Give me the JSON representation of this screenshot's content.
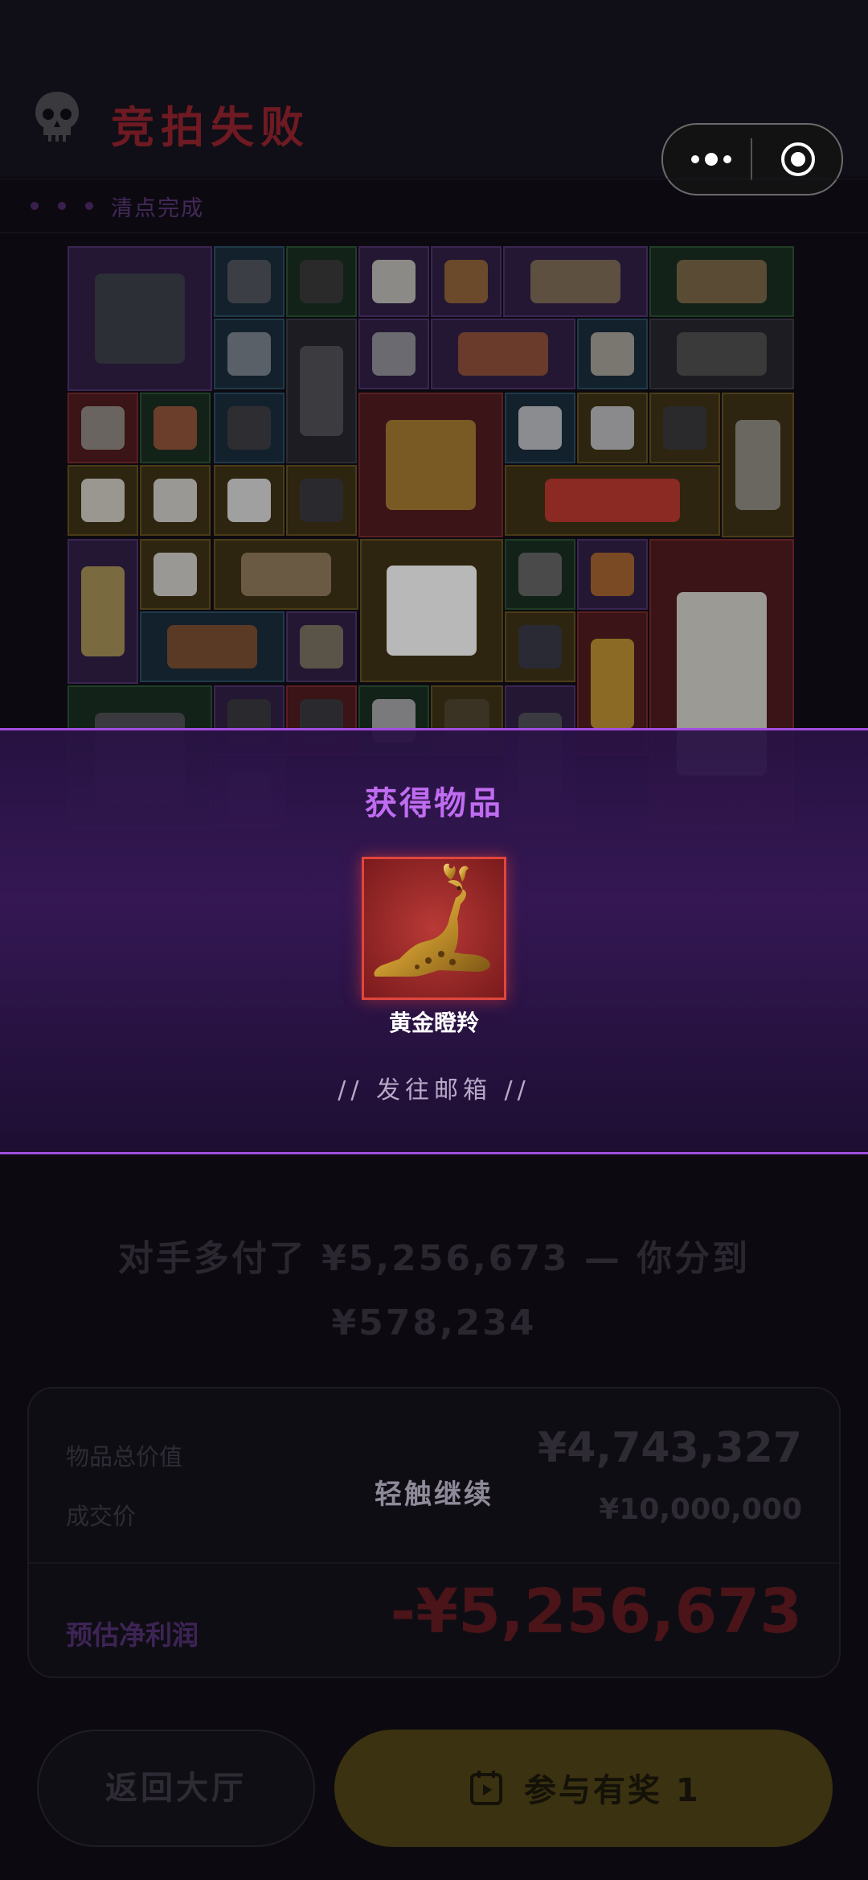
{
  "header": {
    "title": "竞拍失败",
    "subtitle": "清点完成"
  },
  "modal": {
    "title": "获得物品",
    "item_name": "黄金瞪羚",
    "mail_hint": "// 发往邮箱 //",
    "continue_hint": "轻触继续"
  },
  "summary": {
    "line1": "对手多付了 ¥5,256,673 — 你分到",
    "line2": "¥578,234"
  },
  "card": {
    "total_value_label": "物品总价值",
    "total_value": "¥4,743,327",
    "deal_price_label": "成交价",
    "deal_price": "¥10,000,000",
    "profit_label": "预估净利润",
    "profit_value": "-¥5,256,673"
  },
  "buttons": {
    "lobby": "返回大厅",
    "prize": "参与有奖 1"
  },
  "colors": {
    "accent_purple": "#a24ee0",
    "loss_red": "#e0463e",
    "prize_gold": "#3a3210"
  }
}
